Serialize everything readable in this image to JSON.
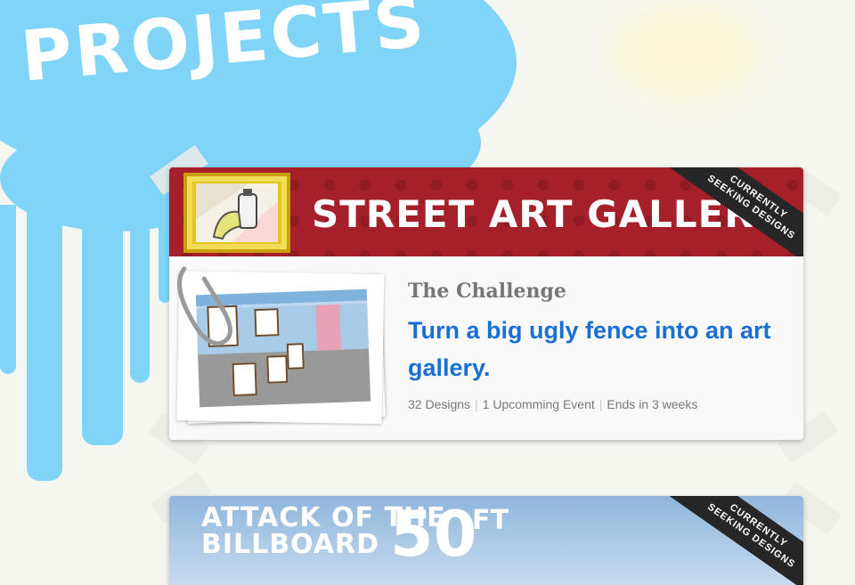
{
  "page": {
    "title": "PROJECTS"
  },
  "projects": [
    {
      "banner_title": "STREET ART GALLERY",
      "ribbon_line1": "CURRENTLY",
      "ribbon_line2": "SEEKING DESIGNS",
      "section_label": "The Challenge",
      "challenge": "Turn a big ugly fence into an art gallery.",
      "stats": {
        "designs": "32 Designs",
        "events": "1 Upcomming Event",
        "ends": "Ends in 3 weeks"
      },
      "banner_color": "#a5202a"
    },
    {
      "banner_line1": "ATTACK OF THE",
      "banner_line2": "BILLBOARD",
      "banner_big": "50",
      "banner_unit": "FT",
      "ribbon_line1": "CURRENTLY",
      "ribbon_line2": "SEEKING DESIGNS"
    }
  ],
  "colors": {
    "splash": "#7fd4f7",
    "link": "#1a6fd4",
    "muted": "#777777"
  },
  "icons": [
    "paperclip-icon",
    "spray-can-icon"
  ]
}
